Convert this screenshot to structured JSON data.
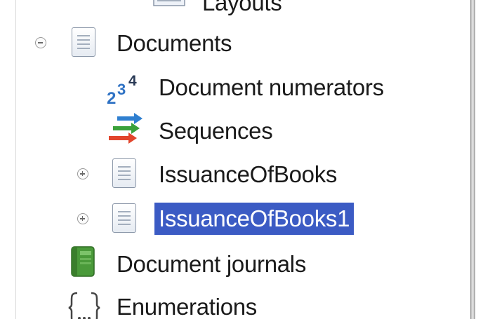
{
  "tree": {
    "partial_top": "Layouts",
    "items": [
      {
        "label": "Documents",
        "expander": "collapse",
        "icon": "document-folder-icon"
      },
      {
        "label": "Document numerators",
        "icon": "numerator-icon",
        "icon_text": {
          "base": "2",
          "mid": "3",
          "top": "4"
        }
      },
      {
        "label": "Sequences",
        "icon": "sequences-icon"
      },
      {
        "label": "IssuanceOfBooks",
        "expander": "expand",
        "icon": "document-icon"
      },
      {
        "label": "IssuanceOfBooks1",
        "expander": "expand",
        "icon": "document-icon",
        "selected": true
      },
      {
        "label": "Document journals",
        "icon": "journal-icon"
      },
      {
        "label": "Enumerations",
        "icon": "enumeration-icon"
      }
    ]
  },
  "colors": {
    "selection": "#3b5bc4",
    "selection_text": "#ffffff",
    "journal": "#4a9a3a",
    "sequence_blue": "#2f7fd0",
    "sequence_green": "#3aa13a",
    "sequence_red": "#e2452c"
  }
}
